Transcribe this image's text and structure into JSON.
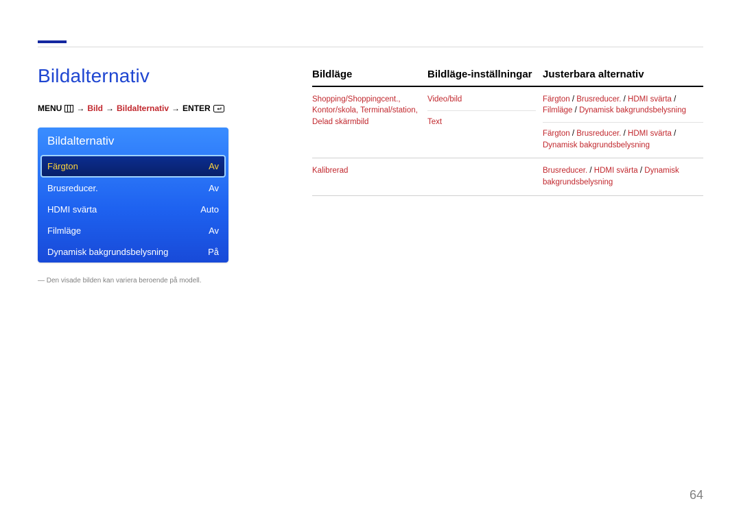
{
  "page_number": "64",
  "main_title": "Bildalternativ",
  "breadcrumb": {
    "menu": "MENU",
    "bild": "Bild",
    "bildalternativ": "Bildalternativ",
    "enter": "ENTER",
    "arrow": "→"
  },
  "osd": {
    "title": "Bildalternativ",
    "rows": [
      {
        "label": "Färgton",
        "value": "Av",
        "selected": true
      },
      {
        "label": "Brusreducer.",
        "value": "Av",
        "selected": false
      },
      {
        "label": "HDMI svärta",
        "value": "Auto",
        "selected": false
      },
      {
        "label": "Filmläge",
        "value": "Av",
        "selected": false
      },
      {
        "label": "Dynamisk bakgrundsbelysning",
        "value": "På",
        "selected": false
      }
    ]
  },
  "footnote": "― Den visade bilden kan variera beroende på modell.",
  "table": {
    "headers": {
      "c1": "Bildläge",
      "c2": "Bildläge-inställningar",
      "c3": "Justerbara alternativ"
    },
    "rows": [
      {
        "c1": "Shopping/Shoppingcent., Kontor/skola, Terminal/station, Delad skärmbild",
        "groups": [
          {
            "c2": "Video/bild",
            "c3": [
              {
                "t": "Färgton",
                "cls": "red"
              },
              {
                "t": " / ",
                "cls": "blk"
              },
              {
                "t": "Brusreducer.",
                "cls": "red"
              },
              {
                "t": " / ",
                "cls": "blk"
              },
              {
                "t": "HDMI svärta",
                "cls": "red"
              },
              {
                "t": " / ",
                "cls": "blk"
              },
              {
                "t": "Filmläge",
                "cls": "red"
              },
              {
                "t": " / ",
                "cls": "blk"
              },
              {
                "t": "Dynamisk bakgrundsbelysning",
                "cls": "red"
              }
            ]
          },
          {
            "c2": "Text",
            "c3": [
              {
                "t": "Färgton",
                "cls": "red"
              },
              {
                "t": " / ",
                "cls": "blk"
              },
              {
                "t": "Brusreducer.",
                "cls": "red"
              },
              {
                "t": " / ",
                "cls": "blk"
              },
              {
                "t": "HDMI svärta",
                "cls": "red"
              },
              {
                "t": " / ",
                "cls": "blk"
              },
              {
                "t": "Dynamisk bakgrundsbelysning",
                "cls": "red"
              }
            ]
          }
        ]
      },
      {
        "c1": "Kalibrerad",
        "groups": [
          {
            "c2": "",
            "c3": [
              {
                "t": "Brusreducer.",
                "cls": "red"
              },
              {
                "t": " / ",
                "cls": "blk"
              },
              {
                "t": "HDMI svärta",
                "cls": "red"
              },
              {
                "t": " / ",
                "cls": "blk"
              },
              {
                "t": "Dynamisk bakgrundsbelysning",
                "cls": "red"
              }
            ]
          }
        ]
      }
    ]
  }
}
